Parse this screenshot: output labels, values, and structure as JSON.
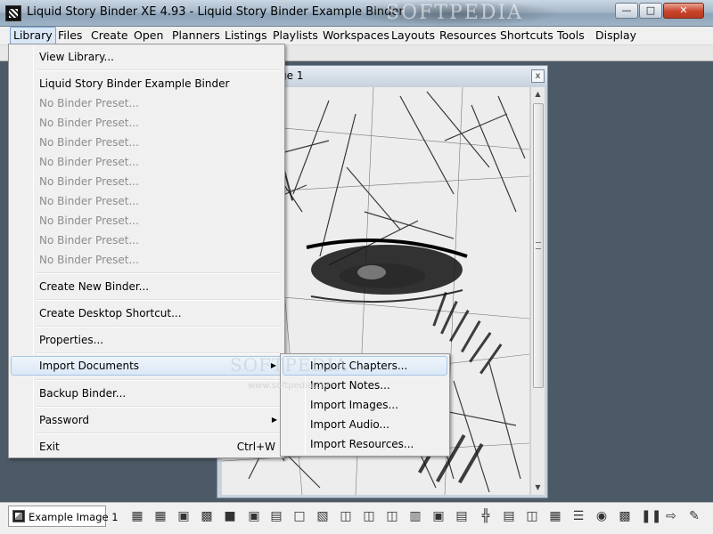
{
  "window": {
    "title": "Liquid Story Binder XE 4.93 - Liquid Story Binder Example Binder",
    "watermark": "SOFTPEDIA",
    "minimize_icon": "minimize-icon",
    "maximize_icon": "maximize-icon",
    "close_icon": "close-icon"
  },
  "menubar": {
    "items": [
      "Library",
      "Files",
      "Create",
      "Open",
      "Planners",
      "Listings",
      "Playlists",
      "Workspaces",
      "Layouts",
      "Resources",
      "Shortcuts",
      "Tools",
      "Display"
    ],
    "active": "Library"
  },
  "image_window": {
    "title": "ge 1",
    "close_glyph": "x"
  },
  "library_menu": {
    "items": [
      {
        "label": "View Library...",
        "state": "normal"
      },
      {
        "label": "Liquid Story Binder Example Binder",
        "state": "normal"
      },
      {
        "label": "No Binder Preset...",
        "state": "disabled"
      },
      {
        "label": "No Binder Preset...",
        "state": "disabled"
      },
      {
        "label": "No Binder Preset...",
        "state": "disabled"
      },
      {
        "label": "No Binder Preset...",
        "state": "disabled"
      },
      {
        "label": "No Binder Preset...",
        "state": "disabled"
      },
      {
        "label": "No Binder Preset...",
        "state": "disabled"
      },
      {
        "label": "No Binder Preset...",
        "state": "disabled"
      },
      {
        "label": "No Binder Preset...",
        "state": "disabled"
      },
      {
        "label": "No Binder Preset...",
        "state": "disabled"
      },
      {
        "label": "Create New Binder...",
        "state": "normal"
      },
      {
        "label": "Create Desktop Shortcut...",
        "state": "normal"
      },
      {
        "label": "Properties...",
        "state": "normal"
      },
      {
        "label": "Import Documents",
        "state": "highlighted",
        "submenu": true
      },
      {
        "label": "Backup Binder...",
        "state": "normal"
      },
      {
        "label": "Password",
        "state": "normal",
        "submenu": true
      },
      {
        "label": "Exit",
        "state": "normal",
        "shortcut": "Ctrl+W"
      }
    ]
  },
  "import_submenu": {
    "items": [
      {
        "label": "Import Chapters...",
        "state": "highlighted"
      },
      {
        "label": "Import Notes...",
        "state": "normal"
      },
      {
        "label": "Import Images...",
        "state": "normal"
      },
      {
        "label": "Import Audio...",
        "state": "normal"
      },
      {
        "label": "Import Resources...",
        "state": "normal"
      }
    ]
  },
  "overlay_watermark": {
    "text": "SOFTPEDIA",
    "url": "www.softpedia.com"
  },
  "taskbar": {
    "tab_label": "Example Image 1",
    "tab_icon": "image-icon",
    "tool_icons": [
      "3d-box-icon",
      "grid-icon",
      "cube-icon",
      "save-disk-icon",
      "square-icon",
      "crop-icon",
      "document-icon",
      "blank-page-icon",
      "table-icon",
      "book-icon",
      "open-book-icon",
      "dotted-grid-icon",
      "picture-icon",
      "storyboard-icon",
      "timeline-icon",
      "checklist-icon",
      "columns-icon",
      "tiles-icon",
      "list-lines-icon",
      "audio-icon",
      "film-icon",
      "pause-icon",
      "import-icon",
      "edit-pen-icon"
    ]
  }
}
